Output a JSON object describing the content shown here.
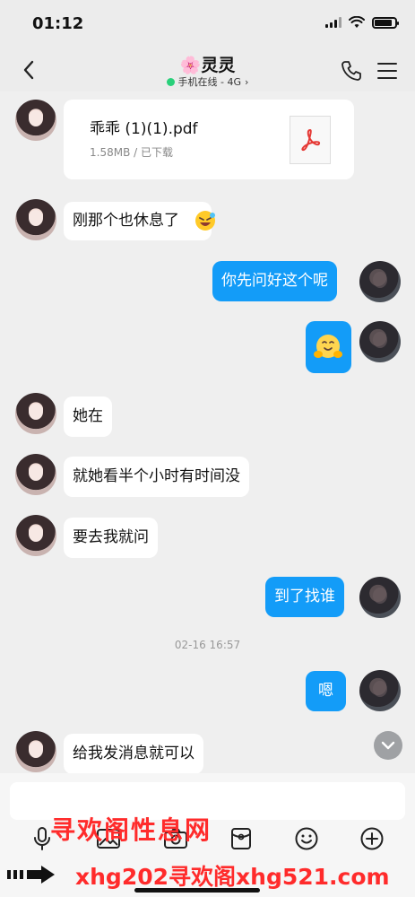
{
  "status_bar": {
    "time": "01:12",
    "battery_level": 0.85
  },
  "header": {
    "title": "灵灵",
    "title_emoji": "🌸",
    "subtitle": "手机在线 - 4G",
    "subtitle_chevron": "›",
    "online_color": "#29d07a",
    "icons": {
      "back": "back-arrow-icon",
      "call": "phone-icon",
      "menu": "menu-icon"
    }
  },
  "file_message": {
    "name": "乖乖 (1)(1).pdf",
    "meta": "1.58MB / 已下载",
    "icon": "pdf-icon"
  },
  "messages": [
    {
      "from": "her",
      "text": "刚那个也休息了",
      "emoji": "laughing-face"
    },
    {
      "from": "me",
      "text": "你先问好这个呢"
    },
    {
      "from": "me",
      "sticker": "hugging-face"
    },
    {
      "from": "her",
      "text": "她在"
    },
    {
      "from": "her",
      "text": "就她看半个小时有时间没"
    },
    {
      "from": "her",
      "text": "要去我就问"
    },
    {
      "from": "me",
      "text": "到了找谁"
    },
    {
      "from": "me",
      "text": "嗯"
    },
    {
      "from": "her",
      "text": "给我发消息就可以"
    }
  ],
  "timestamp": "02-16 16:57",
  "composer": {
    "placeholder": "",
    "toolbar": [
      "microphone-icon",
      "image-icon",
      "camera-icon",
      "red-packet-icon",
      "emoji-icon",
      "plus-icon"
    ]
  },
  "colors": {
    "outgoing_bubble": "#139cf8",
    "incoming_bubble": "#ffffff",
    "watermark": "#ff2b2b"
  },
  "watermark": {
    "line1": "寻欢阁性息网",
    "line2": "xhg202",
    "line3": "寻欢阁xhg521.com"
  }
}
